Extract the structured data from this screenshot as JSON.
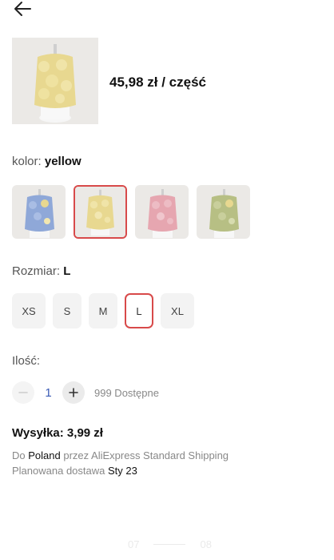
{
  "header": {
    "back_icon": "arrow-left-icon"
  },
  "product": {
    "price": "45,98 zł / część"
  },
  "color": {
    "label": "kolor:",
    "value": "yellow",
    "options": [
      {
        "name": "blue",
        "color": "#8fa8d8"
      },
      {
        "name": "yellow",
        "color": "#e8d890",
        "selected": true
      },
      {
        "name": "pink",
        "color": "#e6a6b0"
      },
      {
        "name": "green",
        "color": "#b7bf84"
      }
    ],
    "accent": "#d84a4a"
  },
  "size": {
    "label": "Rozmiar:",
    "value": "L",
    "options": [
      "XS",
      "S",
      "M",
      "L",
      "XL"
    ],
    "selected": "L"
  },
  "quantity": {
    "label": "Ilość:",
    "value": "1",
    "available": "999 Dostępne"
  },
  "shipping": {
    "title": "Wysyłka: 3,99 zł",
    "to_prefix": "Do",
    "country": "Poland",
    "service": "przez AliExpress Standard Shipping",
    "delivery_label": "Planowana dostawa",
    "delivery_date": "Sty 23"
  },
  "pager": {
    "left": "07",
    "right": "08"
  }
}
